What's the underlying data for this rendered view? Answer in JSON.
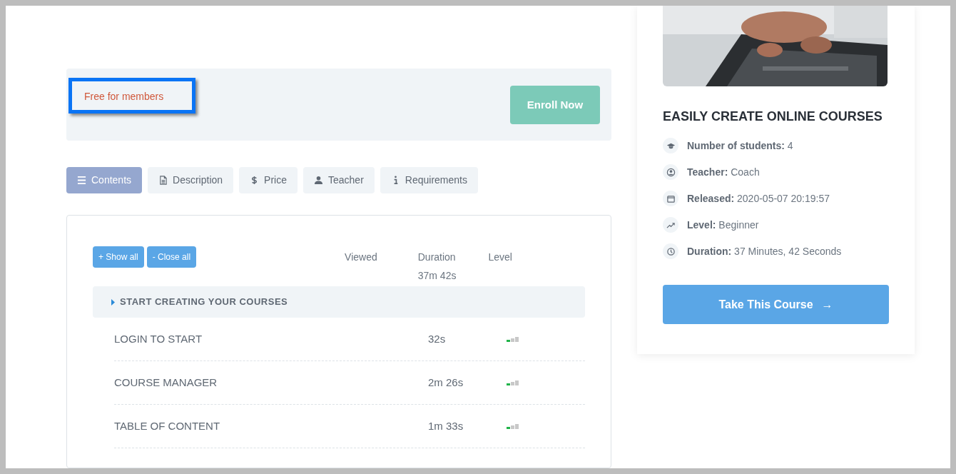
{
  "enroll": {
    "price_note": "Free for members",
    "button": "Enroll Now"
  },
  "tabs": [
    {
      "label": "Contents",
      "kind": "list",
      "selected": true
    },
    {
      "label": "Description",
      "kind": "doc",
      "selected": false
    },
    {
      "label": "Price",
      "kind": "dollar",
      "selected": false
    },
    {
      "label": "Teacher",
      "kind": "user",
      "selected": false
    },
    {
      "label": "Requirements",
      "kind": "info",
      "selected": false
    }
  ],
  "curriculum": {
    "show_all": "+ Show all",
    "close_all": "- Close all",
    "columns": [
      "Viewed",
      "Duration",
      "Level"
    ],
    "total_duration": "37m 42s",
    "section": {
      "title": "START CREATING YOUR COURSES",
      "expanded": false
    },
    "lessons": [
      {
        "title": "LOGIN TO START",
        "duration": "32s",
        "level": 0.33
      },
      {
        "title": "COURSE MANAGER",
        "duration": "2m 26s",
        "level": 0.33
      },
      {
        "title": "TABLE OF CONTENT",
        "duration": "1m 33s",
        "level": 0.33
      }
    ]
  },
  "course_card": {
    "title": "EASILY CREATE ONLINE COURSES",
    "facts": [
      {
        "kind": "cap",
        "label": "Number of students:",
        "value": "4"
      },
      {
        "kind": "person",
        "label": "Teacher:",
        "value": "Coach"
      },
      {
        "kind": "calendar",
        "label": "Released:",
        "value": "2020-05-07 20:19:57"
      },
      {
        "kind": "trend",
        "label": "Level:",
        "value": "Beginner"
      },
      {
        "kind": "clock",
        "label": "Duration:",
        "value": "37 Minutes, 42 Seconds"
      }
    ],
    "button": "Take This Course",
    "button_arrow": "→"
  }
}
